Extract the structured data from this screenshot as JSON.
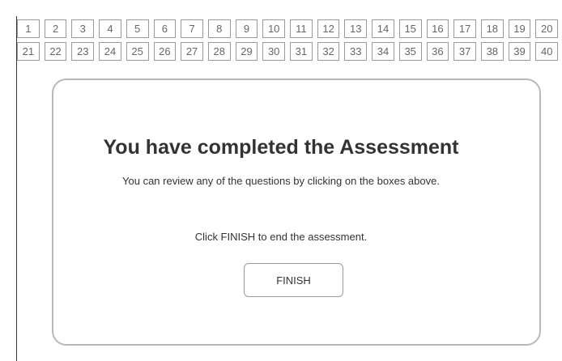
{
  "question_nav": {
    "row1": [
      "1",
      "2",
      "3",
      "4",
      "5",
      "6",
      "7",
      "8",
      "9",
      "10",
      "11",
      "12",
      "13",
      "14",
      "15",
      "16",
      "17",
      "18",
      "19",
      "20"
    ],
    "row2": [
      "21",
      "22",
      "23",
      "24",
      "25",
      "26",
      "27",
      "28",
      "29",
      "30",
      "31",
      "32",
      "33",
      "34",
      "35",
      "36",
      "37",
      "38",
      "39",
      "40"
    ]
  },
  "completion": {
    "title": "You have completed the Assessment",
    "subtitle": "You can review any of the questions by clicking on the boxes above.",
    "instruction": "Click FINISH to end the assessment.",
    "finish_label": "FINISH"
  }
}
